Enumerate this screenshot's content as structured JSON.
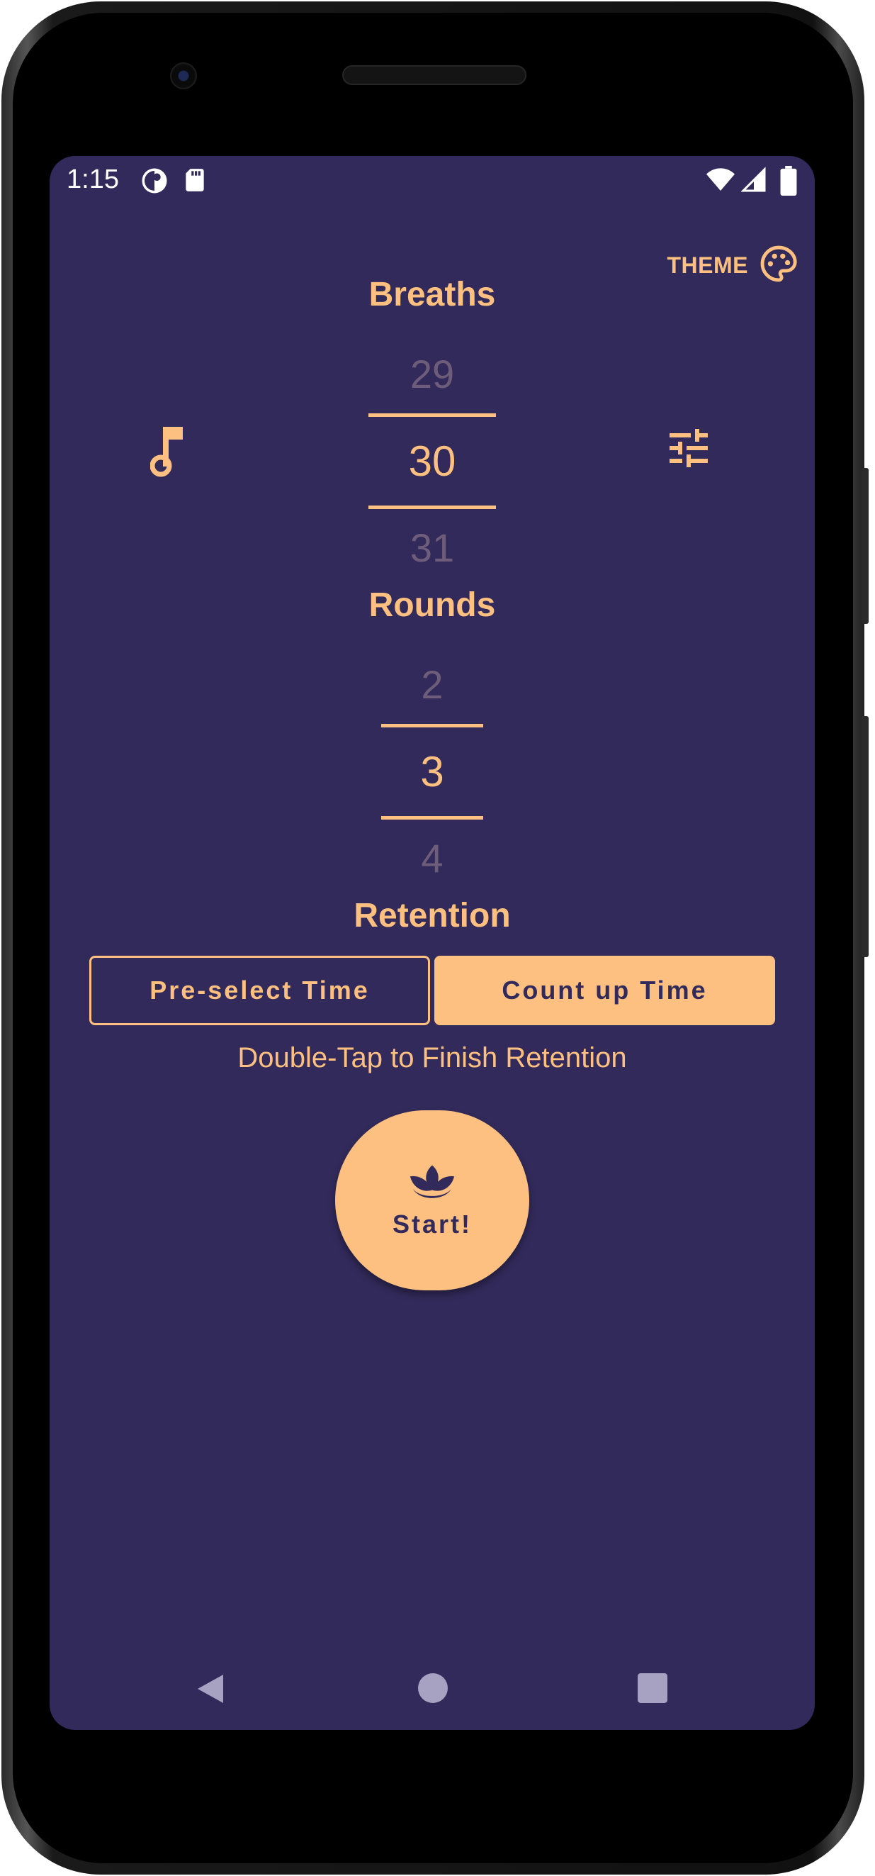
{
  "colors": {
    "background": "#322a5a",
    "accent": "#fdc080",
    "dim_number": "#6e5d7a",
    "nav_icon": "#a7a1c2"
  },
  "status_bar": {
    "time": "1:15",
    "icons": [
      "data-saver-icon",
      "sd-card-icon",
      "wifi-icon",
      "cell-signal-icon",
      "battery-icon"
    ]
  },
  "theme_button": {
    "label": "THEME",
    "icon": "palette-icon"
  },
  "breaths": {
    "title": "Breaths",
    "prev": "29",
    "selected": "30",
    "next": "31"
  },
  "side_buttons": {
    "left_icon": "music-note-icon",
    "right_icon": "tune-sliders-icon"
  },
  "rounds": {
    "title": "Rounds",
    "prev": "2",
    "selected": "3",
    "next": "4"
  },
  "retention": {
    "title": "Retention",
    "options": [
      "Pre-select Time",
      "Count up Time"
    ],
    "selected_index": 1,
    "hint": "Double-Tap to Finish Retention"
  },
  "start_button": {
    "label": "Start!",
    "icon": "lotus-icon"
  },
  "nav_bar": {
    "buttons": [
      "back-icon",
      "home-icon",
      "recents-icon"
    ]
  }
}
